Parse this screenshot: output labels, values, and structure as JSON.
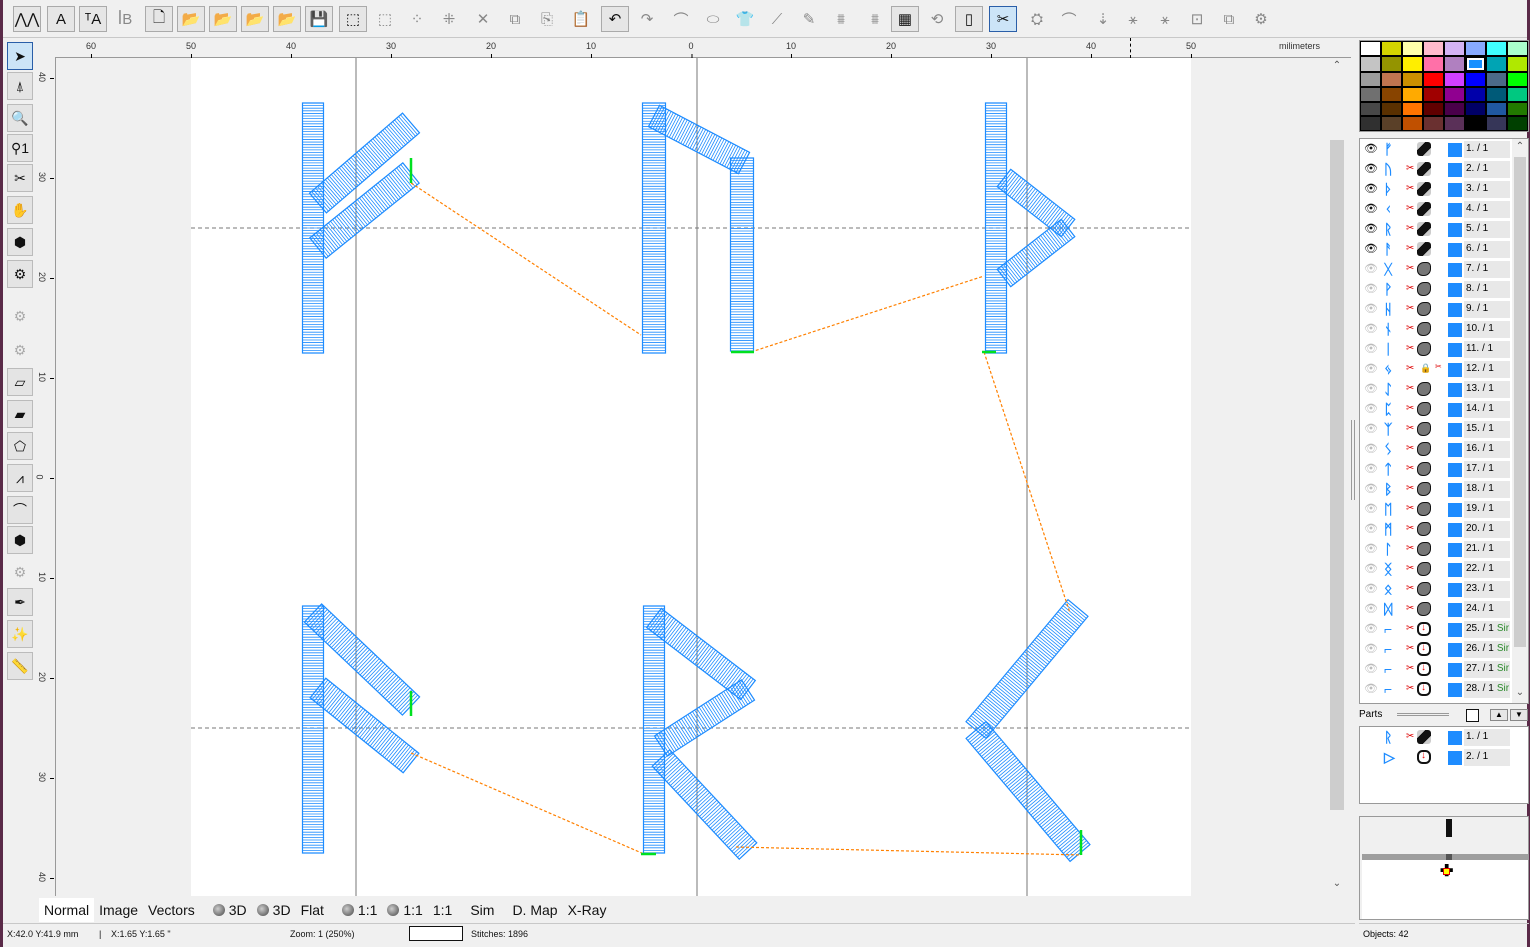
{
  "toolbar": {
    "buttons": [
      {
        "name": "stitch-mode-button",
        "glyph": "⋀⋀",
        "boxed": true
      },
      {
        "name": "text-tool-button",
        "glyph": "A",
        "boxed": true
      },
      {
        "name": "text-path-button",
        "glyph": "ᵀA",
        "boxed": true
      },
      {
        "name": "monogram-button",
        "glyph": "ꟾB",
        "boxed": false
      },
      {
        "name": "new-file-button",
        "glyph": "🗋",
        "boxed": true
      },
      {
        "name": "open-file-button",
        "glyph": "📂",
        "boxed": true
      },
      {
        "name": "import-button",
        "glyph": "📂",
        "boxed": true
      },
      {
        "name": "open-image-button",
        "glyph": "📂",
        "boxed": true
      },
      {
        "name": "open-recent-button",
        "glyph": "📂",
        "boxed": true
      },
      {
        "name": "save-button",
        "glyph": "💾",
        "boxed": true
      },
      {
        "name": "select-all-button",
        "glyph": "⬚",
        "boxed": true
      },
      {
        "name": "rect-select-button",
        "glyph": "⬚",
        "boxed": false
      },
      {
        "name": "lasso-select-button",
        "glyph": "⁘",
        "boxed": false
      },
      {
        "name": "node-select-button",
        "glyph": "⁜",
        "boxed": false
      },
      {
        "name": "delete-button",
        "glyph": "✕",
        "boxed": false
      },
      {
        "name": "group-button",
        "glyph": "⧉",
        "boxed": false
      },
      {
        "name": "copy-button",
        "glyph": "⎘",
        "boxed": false
      },
      {
        "name": "paste-button",
        "glyph": "📋",
        "boxed": false
      },
      {
        "name": "undo-button",
        "glyph": "↶",
        "boxed": true
      },
      {
        "name": "redo-button",
        "glyph": "↷",
        "boxed": false
      },
      {
        "name": "bezier-button",
        "glyph": "⌒",
        "boxed": false
      },
      {
        "name": "shape-button",
        "glyph": "⬭",
        "boxed": false
      },
      {
        "name": "garment-button",
        "glyph": "👕",
        "boxed": false
      },
      {
        "name": "eyedropper-button",
        "glyph": "⟋",
        "boxed": false
      },
      {
        "name": "edit-outline-button",
        "glyph": "✎",
        "boxed": false
      },
      {
        "name": "layer-up-button",
        "glyph": "⩩",
        "boxed": false
      },
      {
        "name": "layer-down-button",
        "glyph": "⩩",
        "boxed": false
      },
      {
        "name": "background-button",
        "glyph": "▦",
        "boxed": true
      },
      {
        "name": "rotate-view-button",
        "glyph": "⟲",
        "boxed": false
      },
      {
        "name": "hoop-button",
        "glyph": "▯",
        "boxed": true
      },
      {
        "name": "view-cuts-button",
        "glyph": "✂",
        "boxed": true,
        "selected": true
      },
      {
        "name": "view-jumps-button",
        "glyph": "⛭",
        "boxed": false
      },
      {
        "name": "curve-button",
        "glyph": "⌒",
        "boxed": false
      },
      {
        "name": "stitch-order-button",
        "glyph": "⇣",
        "boxed": false
      },
      {
        "name": "start-point-button",
        "glyph": "⚹",
        "boxed": false
      },
      {
        "name": "end-point-button",
        "glyph": "⚹",
        "boxed": false
      },
      {
        "name": "fit-button",
        "glyph": "⊡",
        "boxed": false
      },
      {
        "name": "arrange-button",
        "glyph": "⧉",
        "boxed": false
      },
      {
        "name": "settings-button",
        "glyph": "⚙",
        "boxed": false
      }
    ]
  },
  "left_tools": [
    {
      "name": "select-tool",
      "glyph": "➤",
      "selected": true
    },
    {
      "name": "node-edit-tool",
      "glyph": "⍋"
    },
    {
      "name": "zoom-tool",
      "glyph": "🔍"
    },
    {
      "name": "zoom-1-tool",
      "glyph": "⚲1"
    },
    {
      "name": "crop-tool",
      "glyph": "✂"
    },
    {
      "name": "pan-tool",
      "glyph": "✋"
    },
    {
      "name": "fill-shape-tool",
      "glyph": "⬢"
    },
    {
      "name": "auto-digitize-tool",
      "glyph": "⚙"
    },
    {
      "name": "disabled-tool-1",
      "glyph": "⚙",
      "disabled": true
    },
    {
      "name": "disabled-tool-2",
      "glyph": "⚙",
      "disabled": true
    },
    {
      "name": "satin-column-tool",
      "glyph": "▱"
    },
    {
      "name": "satin-fill-tool",
      "glyph": "▰"
    },
    {
      "name": "outline-tool",
      "glyph": "⬠"
    },
    {
      "name": "zigzag-tool",
      "glyph": "⩘"
    },
    {
      "name": "curve-tool",
      "glyph": "⌒"
    },
    {
      "name": "applique-tool",
      "glyph": "⬢"
    },
    {
      "name": "disabled-tool-3",
      "glyph": "⚙",
      "disabled": true
    },
    {
      "name": "pen-tool",
      "glyph": "✒"
    },
    {
      "name": "magic-wand-tool",
      "glyph": "✨"
    },
    {
      "name": "measure-tool",
      "glyph": "📏"
    }
  ],
  "ruler": {
    "unit_label": "milimeters",
    "h_ticks": [
      "60",
      "50",
      "40",
      "30",
      "20",
      "10",
      "0",
      "10",
      "20",
      "30",
      "40",
      "50"
    ],
    "v_ticks": [
      "40",
      "30",
      "20",
      "10",
      "0",
      "10",
      "20",
      "30",
      "40"
    ]
  },
  "colors": {
    "stitch": "#1e8cff",
    "jump": "#ff8000",
    "start_end": "#00e020",
    "hoop_bg": "#ffffff",
    "canvas_bg": "#f0f0f0"
  },
  "view_tabs": [
    {
      "label": "Normal",
      "active": true
    },
    {
      "label": "Image"
    },
    {
      "label": "Vectors"
    },
    {
      "label": "3D",
      "ball": true
    },
    {
      "label": "3D",
      "ball": true
    },
    {
      "label": "Flat"
    },
    {
      "label": "1:1",
      "ball": true
    },
    {
      "label": "1:1",
      "ball": true
    },
    {
      "label": "1:1"
    },
    {
      "label": "Sim"
    },
    {
      "label": "D. Map"
    },
    {
      "label": "X-Ray"
    }
  ],
  "status": {
    "mm_coords": "X:42.0  Y:41.9 mm",
    "sep": "|",
    "inch_coords": "X:1.65  Y:1.65 \"",
    "zoom": "Zoom: 1 (250%)",
    "stitches": "Stitches: 1896",
    "objects": "Objects: 42"
  },
  "palette": [
    "#ffffff",
    "#d4d400",
    "#ffffaa",
    "#ffbbcc",
    "#d4b4f4",
    "#88aaff",
    "#40ffff",
    "#aaffcc",
    "#c4c4c4",
    "#949400",
    "#ffee00",
    "#ff70a8",
    "#b080c0",
    "#1890ff",
    "#00a4b4",
    "#b0e800",
    "#9c9c9c",
    "#c07450",
    "#cc9000",
    "#ff0000",
    "#d040ff",
    "#0000ff",
    "#4c6a88",
    "#00ff00",
    "#707070",
    "#884400",
    "#ffaa00",
    "#a00000",
    "#900090",
    "#0000aa",
    "#005a78",
    "#00c880",
    "#484848",
    "#5a3000",
    "#ff7400",
    "#600000",
    "#4a004a",
    "#000066",
    "#2058a0",
    "#227a00",
    "#303030",
    "#5a4028",
    "#c05000",
    "#6a3030",
    "#5a3058",
    "#000000",
    "#363658",
    "#004000"
  ],
  "selected_color_index": 13,
  "objects": [
    {
      "n": "1. / 1",
      "glyph": "ᚠ",
      "visible": true,
      "cut": false,
      "type": "satin"
    },
    {
      "n": "2. / 1",
      "glyph": "ᚢ",
      "visible": true,
      "cut": true,
      "type": "satin"
    },
    {
      "n": "3. / 1",
      "glyph": "ᚦ",
      "visible": true,
      "cut": true,
      "type": "satin"
    },
    {
      "n": "4. / 1",
      "glyph": "ᚲ",
      "visible": true,
      "cut": true,
      "type": "satin"
    },
    {
      "n": "5. / 1",
      "glyph": "ᚱ",
      "visible": true,
      "cut": true,
      "type": "satin"
    },
    {
      "n": "6. / 1",
      "glyph": "ᚨ",
      "visible": true,
      "cut": true,
      "type": "satin"
    },
    {
      "n": "7. / 1",
      "glyph": "ᚷ",
      "visible": false,
      "cut": true,
      "type": "fill"
    },
    {
      "n": "8. / 1",
      "glyph": "ᚹ",
      "visible": false,
      "cut": true,
      "type": "fill"
    },
    {
      "n": "9. / 1",
      "glyph": "ᚺ",
      "visible": false,
      "cut": true,
      "type": "fill"
    },
    {
      "n": "10. / 1",
      "glyph": "ᚾ",
      "visible": false,
      "cut": true,
      "type": "fill"
    },
    {
      "n": "11. / 1",
      "glyph": "ᛁ",
      "visible": false,
      "cut": true,
      "type": "fill"
    },
    {
      "n": "12. / 1",
      "glyph": "ᛃ",
      "visible": false,
      "cut": true,
      "type": "lock",
      "cutmark": true
    },
    {
      "n": "13. / 1",
      "glyph": "ᛇ",
      "visible": false,
      "cut": true,
      "type": "fill"
    },
    {
      "n": "14. / 1",
      "glyph": "ᛈ",
      "visible": false,
      "cut": true,
      "type": "fill"
    },
    {
      "n": "15. / 1",
      "glyph": "ᛉ",
      "visible": false,
      "cut": true,
      "type": "fill"
    },
    {
      "n": "16. / 1",
      "glyph": "ᛊ",
      "visible": false,
      "cut": true,
      "type": "fill"
    },
    {
      "n": "17. / 1",
      "glyph": "ᛏ",
      "visible": false,
      "cut": true,
      "type": "fill"
    },
    {
      "n": "18. / 1",
      "glyph": "ᛒ",
      "visible": false,
      "cut": true,
      "type": "fill"
    },
    {
      "n": "19. / 1",
      "glyph": "ᛖ",
      "visible": false,
      "cut": true,
      "type": "fill"
    },
    {
      "n": "20. / 1",
      "glyph": "ᛗ",
      "visible": false,
      "cut": true,
      "type": "fill"
    },
    {
      "n": "21. / 1",
      "glyph": "ᛚ",
      "visible": false,
      "cut": true,
      "type": "fill"
    },
    {
      "n": "22. / 1",
      "glyph": "ᛝ",
      "visible": false,
      "cut": true,
      "type": "fill"
    },
    {
      "n": "23. / 1",
      "glyph": "ᛟ",
      "visible": false,
      "cut": true,
      "type": "fill"
    },
    {
      "n": "24. / 1",
      "glyph": "ᛞ",
      "visible": false,
      "cut": true,
      "type": "fill"
    },
    {
      "n": "25. / 1",
      "glyph": "⌐",
      "visible": false,
      "cut": true,
      "type": "run",
      "extra": "Sir"
    },
    {
      "n": "26. / 1",
      "glyph": "⌐",
      "visible": false,
      "cut": true,
      "type": "run",
      "extra": "Sir"
    },
    {
      "n": "27. / 1",
      "glyph": "⌐",
      "visible": false,
      "cut": true,
      "type": "run",
      "extra": "Sir"
    },
    {
      "n": "28. / 1",
      "glyph": "⌐",
      "visible": false,
      "cut": true,
      "type": "run",
      "extra": "Sir"
    }
  ],
  "parts": {
    "title": "Parts",
    "items": [
      {
        "n": "1. / 1",
        "glyph": "ᚱ",
        "cut": true,
        "type": "satin"
      },
      {
        "n": "2. / 1",
        "glyph": "▷",
        "cut": false,
        "type": "run"
      }
    ]
  }
}
